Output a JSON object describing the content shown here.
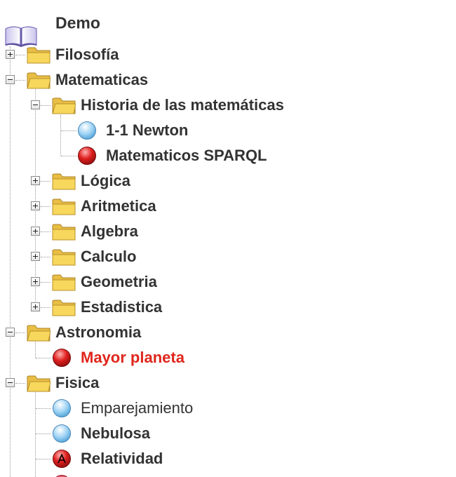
{
  "tree": {
    "root": {
      "label": "Demo",
      "icon": "book-icon"
    },
    "nodes": [
      {
        "id": "filosofia",
        "label": "Filosofía",
        "type": "folder",
        "expanded": false
      },
      {
        "id": "matematicas",
        "label": "Matematicas",
        "type": "folder",
        "expanded": true
      },
      {
        "id": "historia",
        "label": "Historia de las matemáticas",
        "type": "folder",
        "expanded": true
      },
      {
        "id": "newton",
        "label": "1-1 Newton",
        "type": "item",
        "icon": "blue-bullet-icon"
      },
      {
        "id": "sparql",
        "label": "Matematicos SPARQL",
        "type": "item",
        "icon": "red-bullet-icon"
      },
      {
        "id": "logica",
        "label": "Lógica",
        "type": "folder",
        "expanded": false
      },
      {
        "id": "aritmetica",
        "label": "Aritmetica",
        "type": "folder",
        "expanded": false
      },
      {
        "id": "algebra",
        "label": "Algebra",
        "type": "folder",
        "expanded": false
      },
      {
        "id": "calculo",
        "label": "Calculo",
        "type": "folder",
        "expanded": false
      },
      {
        "id": "geometria",
        "label": "Geometria",
        "type": "folder",
        "expanded": false
      },
      {
        "id": "estadistica",
        "label": "Estadistica",
        "type": "folder",
        "expanded": false
      },
      {
        "id": "astronomia",
        "label": "Astronomia",
        "type": "folder",
        "expanded": true
      },
      {
        "id": "mayor_planeta",
        "label": "Mayor planeta",
        "type": "item",
        "icon": "red-bullet-icon",
        "highlighted": true
      },
      {
        "id": "fisica",
        "label": "Fisica",
        "type": "folder",
        "expanded": true
      },
      {
        "id": "emparejamiento",
        "label": "Emparejamiento",
        "type": "item",
        "icon": "blue-bullet-icon"
      },
      {
        "id": "nebulosa",
        "label": "Nebulosa",
        "type": "item",
        "icon": "blue-bullet-icon"
      },
      {
        "id": "relatividad",
        "label": "Relatividad",
        "type": "item",
        "icon": "red-bullet-a-icon"
      }
    ]
  },
  "colors": {
    "text": "#333333",
    "highlight": "#e0251b",
    "folder_body": "#f7d75c",
    "folder_edge": "#b8902a",
    "bullet_blue": "#8cc8ee",
    "bullet_red": "#d82020"
  }
}
